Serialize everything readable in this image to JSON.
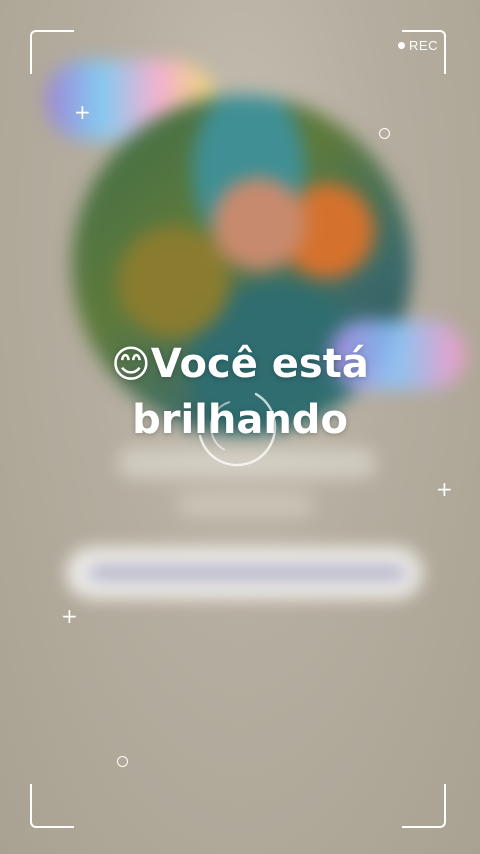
{
  "recording_indicator": {
    "label": "REC"
  },
  "headline": {
    "emoji": "😊",
    "line1": "Você está",
    "line2": "brilhando"
  },
  "colors": {
    "background": "#b3ab9d",
    "overlay_text": "#ffffff"
  },
  "icons": [
    "rec-dot-icon",
    "sparkle-icon",
    "ring-icon",
    "loading-spinner-icon",
    "smile-emoji-icon"
  ]
}
